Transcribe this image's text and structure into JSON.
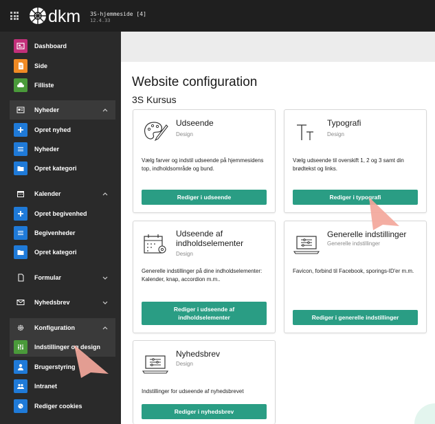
{
  "topbar": {
    "site_name": "3S-hjemmeside [4]",
    "version": "12.4.33",
    "logo_text": "dkm"
  },
  "sidebar": {
    "dashboard": "Dashboard",
    "side": "Side",
    "filliste": "Filliste",
    "nyheder_group": "Nyheder",
    "opret_nyhed": "Opret nyhed",
    "nyheder": "Nyheder",
    "opret_kategori_1": "Opret kategori",
    "kalender_group": "Kalender",
    "opret_begivenhed": "Opret begivenhed",
    "begivenheder": "Begivenheder",
    "opret_kategori_2": "Opret kategori",
    "formular": "Formular",
    "nyhedsbrev": "Nyhedsbrev",
    "konfiguration_group": "Konfiguration",
    "indstillinger_design": "Indstillinger og design",
    "brugerstyring": "Brugerstyring",
    "intranet": "Intranet",
    "rediger_cookies": "Rediger cookies"
  },
  "main": {
    "title": "Website configuration",
    "subtitle": "3S Kursus"
  },
  "cards": {
    "udseende": {
      "title": "Udseende",
      "sub": "Design",
      "desc": "Vælg farver og indstil udseende på hjemmesidens top, indholdsområde og bund.",
      "button": "Rediger i udseende"
    },
    "typografi": {
      "title": "Typografi",
      "sub": "Design",
      "desc": "Vælg udseende til overskift 1, 2 og 3 samt din brødtekst og links.",
      "button": "Rediger i typografi"
    },
    "indholdselementer": {
      "title": "Udseende af indholdselementer",
      "sub": "Design",
      "desc": "Generelle indstillinger på dine indholdselementer: Kalender, knap, accordion m.m..",
      "button": "Rediger i udseende af indholdselementer"
    },
    "generelle": {
      "title": "Generelle indstillinger",
      "sub": "Generelle indstillinger",
      "desc": "Favicon, forbind til Facebook, sporings-ID'er m.m.",
      "button": "Rediger i generelle indstillinger"
    },
    "nyhedsbrev": {
      "title": "Nyhedsbrev",
      "sub": "Design",
      "desc": "Indstillinger for udseende af nyhedsbrevet",
      "button": "Rediger i nyhedsbrev"
    }
  },
  "colors": {
    "accent_green": "#2a9d84",
    "sidebar_bg": "#2a2a2a",
    "topbar_bg": "#1f1f1f",
    "icon_magenta": "#c2307a",
    "icon_orange": "#f08a24",
    "icon_green": "#4a9a3a",
    "icon_blue": "#1f7ad8",
    "cursor_pink": "#f3a79b"
  },
  "icons": {
    "apps": "grid-icon",
    "dashboard": "dashboard-icon",
    "side": "page-icon",
    "filliste": "cloud-icon",
    "nyheder": "newspaper-icon",
    "opret": "plus-icon",
    "list": "list-icon",
    "folder": "folder-icon",
    "kalender": "calendar-icon",
    "formular": "document-icon",
    "nyhedsbrev": "envelope-icon",
    "konfiguration": "gear-icon",
    "indstillinger": "sliders-icon",
    "brugerstyring": "user-icon",
    "intranet": "users-icon",
    "cookies": "cookie-icon"
  }
}
